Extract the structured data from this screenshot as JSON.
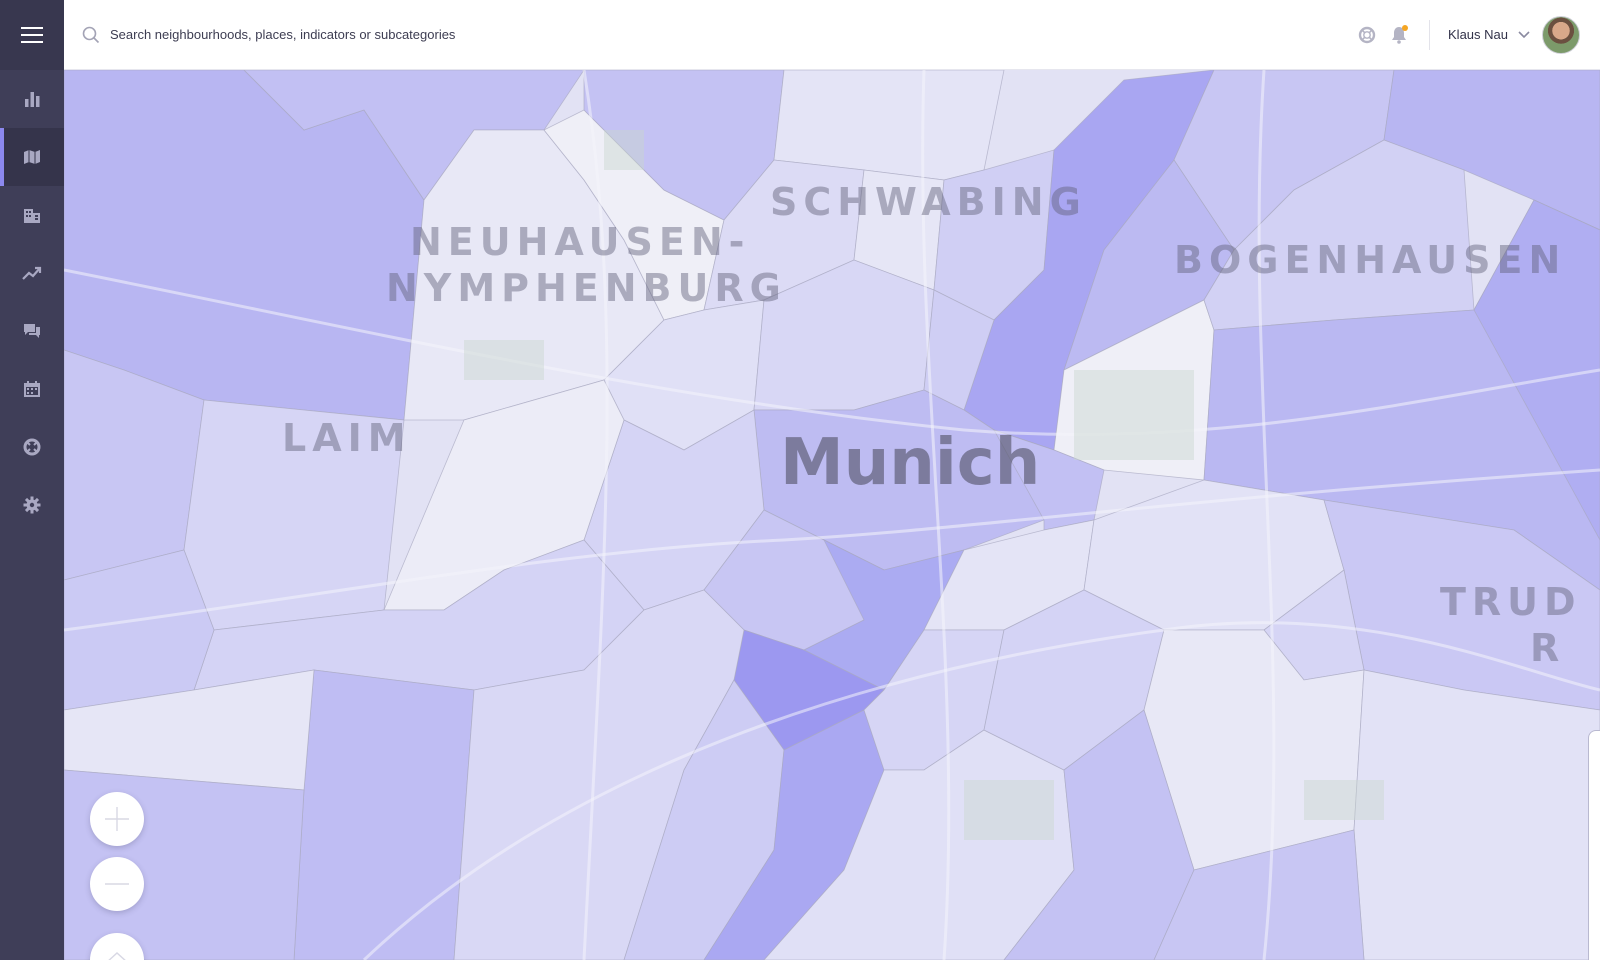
{
  "header": {
    "search_placeholder": "Search neighbourhoods, places, indicators or subcategories",
    "user_name": "Klaus Nau",
    "icons": [
      "search-icon",
      "help-icon",
      "bell-icon",
      "chevron-down-icon"
    ],
    "notification_color": "#f5a623"
  },
  "sidebar": {
    "items": [
      {
        "name": "dashboard",
        "icon": "bar-chart-icon",
        "active": false
      },
      {
        "name": "map",
        "icon": "map-icon",
        "active": true
      },
      {
        "name": "buildings",
        "icon": "buildings-icon",
        "active": false
      },
      {
        "name": "trends",
        "icon": "trending-up-icon",
        "active": false
      },
      {
        "name": "messages",
        "icon": "chat-icon",
        "active": false
      },
      {
        "name": "calendar",
        "icon": "calendar-icon",
        "active": false
      },
      {
        "name": "support",
        "icon": "lifebuoy-icon",
        "active": false
      },
      {
        "name": "settings",
        "icon": "gear-icon",
        "active": false
      }
    ],
    "background": "#3f3e58",
    "accent": "#8c88ee"
  },
  "map": {
    "city_label": "Munich",
    "district_labels": [
      "SCHWABING",
      "NEUHAUSEN-",
      "NYMPHENBURG",
      "BOGENHAUSEN",
      "LAIM",
      "TRUD",
      "R"
    ],
    "choropleth_colors": [
      "#b8b6f2",
      "#c8c6f3",
      "#d6d5f5",
      "#e4e4f6",
      "#efeff7",
      "#a9a6f2",
      "#9c98f0"
    ]
  },
  "controls": {
    "zoom_in_icon": "plus-icon",
    "zoom_out_icon": "minus-icon",
    "tilt_icon": "chevron-up-icon"
  }
}
